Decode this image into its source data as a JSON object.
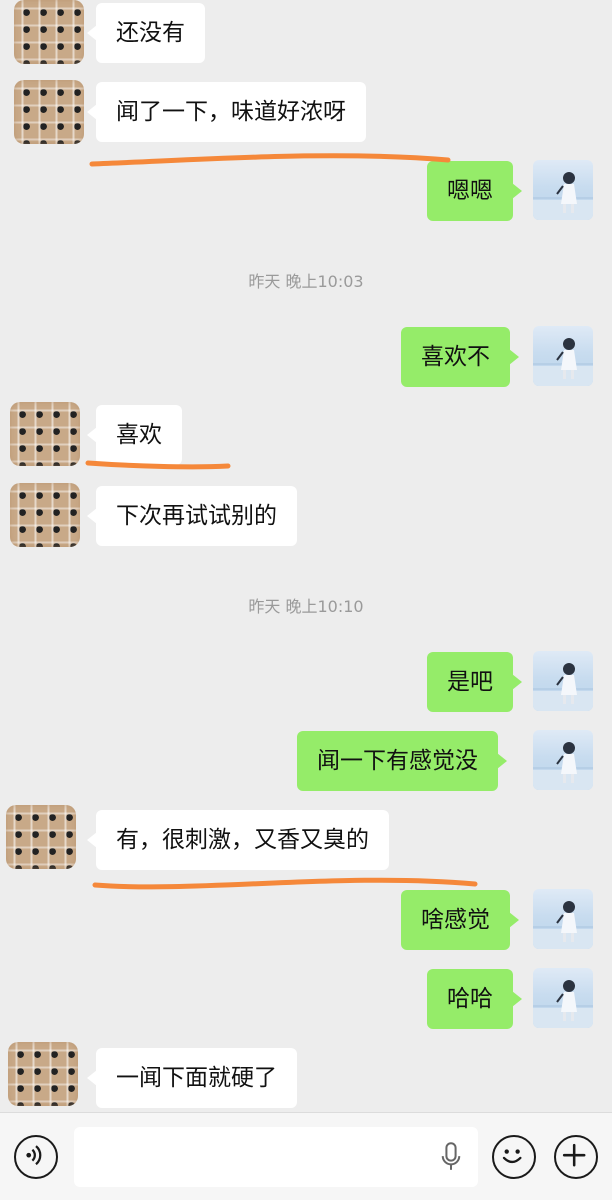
{
  "messages": [
    {
      "side": "left",
      "text": "还没有"
    },
    {
      "side": "left",
      "text": "闻了一下，味道好浓呀"
    },
    {
      "side": "right",
      "text": "嗯嗯"
    },
    {
      "type": "time",
      "text": "昨天 晚上10:03"
    },
    {
      "side": "right",
      "text": "喜欢不"
    },
    {
      "side": "left",
      "text": "喜欢"
    },
    {
      "side": "left",
      "text": "下次再试试别的"
    },
    {
      "type": "time",
      "text": "昨天 晚上10:10"
    },
    {
      "side": "right",
      "text": "是吧"
    },
    {
      "side": "right",
      "text": "闻一下有感觉没"
    },
    {
      "side": "left",
      "text": "有，很刺激，又香又臭的"
    },
    {
      "side": "right",
      "text": "啥感觉"
    },
    {
      "side": "right",
      "text": "哈哈"
    },
    {
      "side": "left",
      "text": "一闻下面就硬了"
    }
  ],
  "input_bar": {
    "voice_icon": "voice-icon",
    "mic_icon": "microphone-icon",
    "emoji_icon": "emoji-icon",
    "plus_icon": "plus-icon",
    "input_value": ""
  },
  "colors": {
    "background": "#ededed",
    "my_bubble": "#95ec69",
    "their_bubble": "#ffffff",
    "annotation_stroke": "#f5883a"
  }
}
